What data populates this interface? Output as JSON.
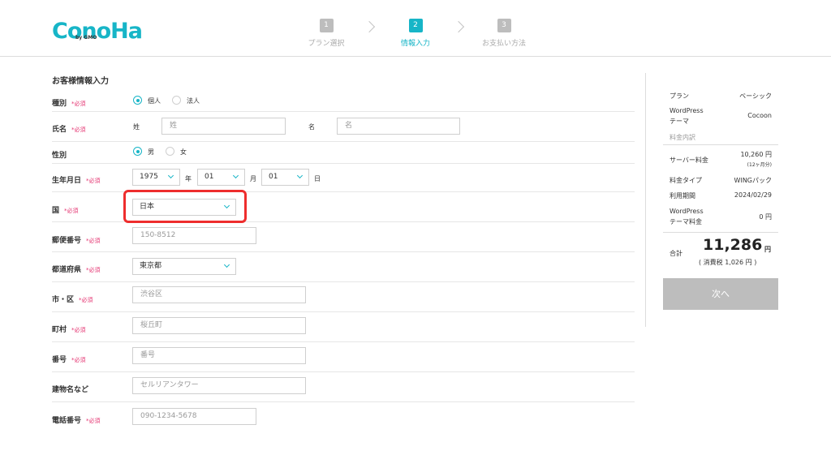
{
  "header": {
    "logo_text": "ConoHa",
    "logo_sub": "by GMO",
    "steps": [
      {
        "num": "1",
        "label": "プラン選択"
      },
      {
        "num": "2",
        "label": "情報入力"
      },
      {
        "num": "3",
        "label": "お支払い方法"
      }
    ]
  },
  "form": {
    "title": "お客様情報入力",
    "required": "*必須",
    "type": {
      "label": "種別",
      "options": [
        "個人",
        "法人"
      ],
      "selected": "個人"
    },
    "name": {
      "label": "氏名",
      "sei_label": "姓",
      "sei_placeholder": "姓",
      "mei_label": "名",
      "mei_placeholder": "名"
    },
    "gender": {
      "label": "性別",
      "options": [
        "男",
        "女"
      ],
      "selected": "男"
    },
    "birth": {
      "label": "生年月日",
      "year": "1975",
      "year_unit": "年",
      "month": "01",
      "month_unit": "月",
      "day": "01",
      "day_unit": "日"
    },
    "country": {
      "label": "国",
      "value": "日本"
    },
    "postal": {
      "label": "郵便番号",
      "placeholder": "150-8512"
    },
    "prefecture": {
      "label": "都道府県",
      "value": "東京都"
    },
    "city": {
      "label": "市・区",
      "placeholder": "渋谷区"
    },
    "town": {
      "label": "町村",
      "placeholder": "桜丘町"
    },
    "number": {
      "label": "番号",
      "placeholder": "番号"
    },
    "building": {
      "label": "建物名など",
      "placeholder": "セルリアンタワー"
    },
    "phone": {
      "label": "電話番号",
      "placeholder": "090-1234-5678"
    }
  },
  "summary": {
    "plan_key": "プラン",
    "plan_val": "ベーシック",
    "wp_theme_key_1": "WordPress",
    "wp_theme_key_2": "テーマ",
    "wp_theme_val": "Cocoon",
    "breakdown": "料金内訳",
    "server_key": "サーバー料金",
    "server_val": "10,260 円",
    "server_sub": "(12ヶ月分)",
    "fee_type_key": "料金タイプ",
    "fee_type_val": "WINGパック",
    "period_key": "利用期間",
    "period_val": "2024/02/29",
    "wp_fee_key_1": "WordPress",
    "wp_fee_key_2": "テーマ料金",
    "wp_fee_val": "0 円",
    "total_key": "合計",
    "total_val": "11,286",
    "total_unit": "円",
    "tax": "( 消費税 1,026 円 )",
    "next_label": "次へ"
  },
  "colors": {
    "accent": "#17b5c7",
    "required": "#e4316f",
    "highlight": "#ee2d2d",
    "button_disabled": "#bdbdbd"
  }
}
